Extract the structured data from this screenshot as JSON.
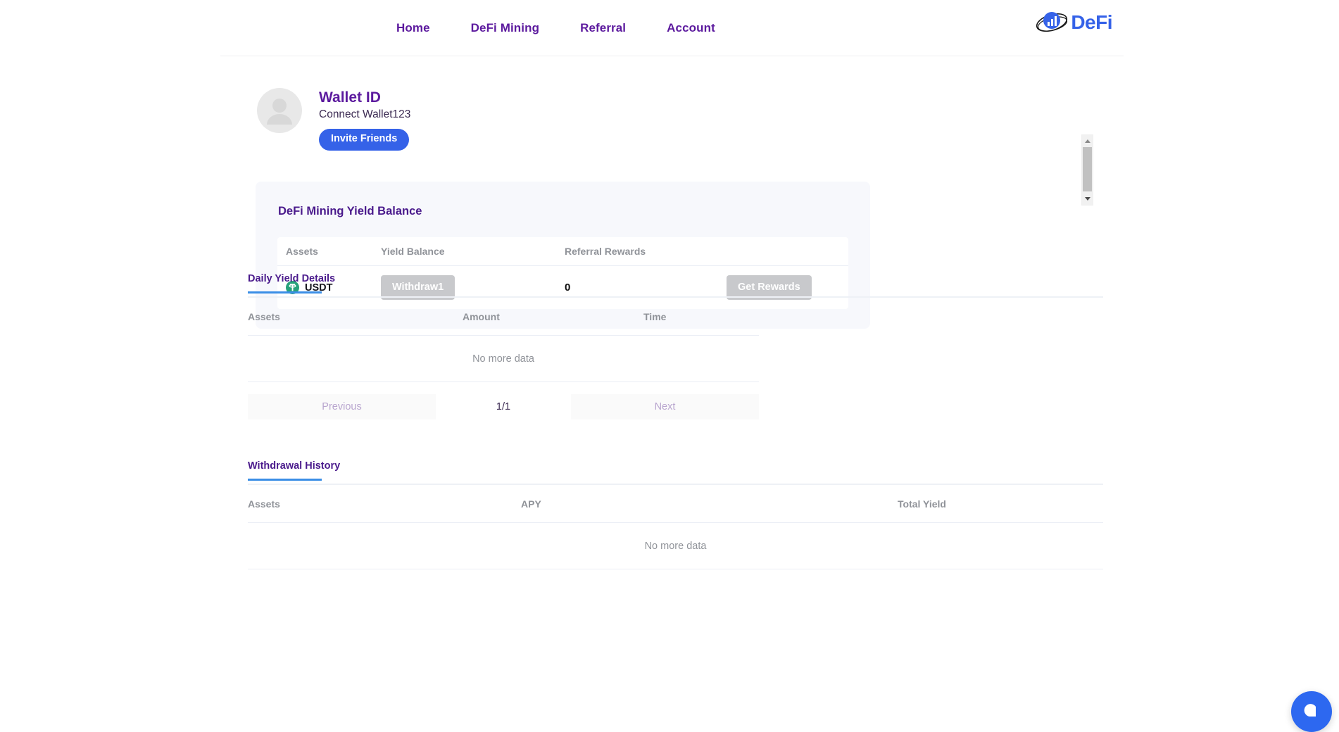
{
  "header": {
    "nav": [
      {
        "label": "Home",
        "name": "nav-home"
      },
      {
        "label": "DeFi Mining",
        "name": "nav-defi-mining"
      },
      {
        "label": "Referral",
        "name": "nav-referral"
      },
      {
        "label": "Account",
        "name": "nav-account"
      }
    ],
    "logo_text": "DeFi",
    "logo_icon": "globe-bar-chart-icon",
    "nav_color": "#5c1a9e",
    "logo_color": "#3562e8"
  },
  "profile": {
    "avatar_icon": "user-avatar-icon",
    "wallet_title": "Wallet ID",
    "wallet_connect": "Connect Wallet123",
    "invite_label": "Invite Friends",
    "invite_color": "#3562e8"
  },
  "scrollbar": {
    "up_icon": "caret-up-icon",
    "down_icon": "caret-down-icon"
  },
  "yield_card": {
    "title": "DeFi Mining Yield Balance",
    "columns": {
      "assets": "Assets",
      "yield_balance": "Yield Balance",
      "referral_rewards": "Referral Rewards"
    },
    "row": {
      "asset": "USDT",
      "asset_icon": "tether-usdt-icon",
      "asset_icon_color": "#26a17b",
      "withdraw_label": "Withdraw1",
      "referral_value": "0",
      "get_rewards_label": "Get Rewards",
      "button_color": "#c8c9cc"
    },
    "background": "#f7f8fc"
  },
  "daily_yield": {
    "tab_label": "Daily Yield Details",
    "tab_underline_color": "#3a8ee6",
    "columns": {
      "assets": "Assets",
      "amount": "Amount",
      "time": "Time"
    },
    "empty_text": "No more data",
    "pagination": {
      "previous": "Previous",
      "page": "1/1",
      "next": "Next"
    }
  },
  "withdrawal_history": {
    "tab_label": "Withdrawal History",
    "columns": {
      "assets": "Assets",
      "apy": "APY",
      "total_yield": "Total Yield"
    },
    "empty_text": "No more data"
  },
  "chat_widget": {
    "icon": "chat-bubble-icon",
    "color": "#2d68f0"
  }
}
